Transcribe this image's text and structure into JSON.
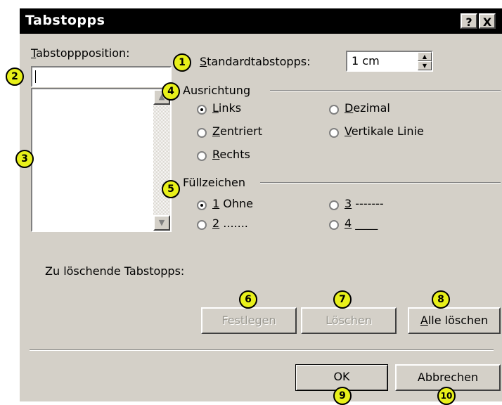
{
  "window": {
    "title": "Tabstopps",
    "help_btn": "?",
    "close_btn": "X"
  },
  "position": {
    "label_u": "T",
    "label_rest": "abstoppposition:",
    "value": "",
    "items": []
  },
  "standard": {
    "label_u": "S",
    "label_rest": "tandardtabstopps:",
    "value": "1 cm"
  },
  "alignment": {
    "title": "Ausrichtung",
    "options": [
      {
        "u": "L",
        "rest": "inks",
        "checked": true
      },
      {
        "u": "D",
        "rest": "ezimal",
        "checked": false
      },
      {
        "u": "Z",
        "rest": "entriert",
        "checked": false
      },
      {
        "u": "V",
        "rest": "ertikale Linie",
        "checked": false
      },
      {
        "u": "R",
        "rest": "echts",
        "checked": false
      }
    ]
  },
  "fill": {
    "title": "Füllzeichen",
    "options": [
      {
        "u": "1",
        "rest": " Ohne",
        "checked": true
      },
      {
        "u": "3",
        "rest": " -------",
        "checked": false
      },
      {
        "u": "2",
        "rest": " .......",
        "checked": false
      },
      {
        "u": "4",
        "rest": " ____",
        "checked": false
      }
    ]
  },
  "delete_label": "Zu löschende Tabstopps:",
  "buttons": {
    "set": "Festlegen",
    "delete": "Löschen",
    "delete_all_u": "A",
    "delete_all_rest": "lle löschen",
    "ok": "OK",
    "cancel": "Abbrechen"
  },
  "badges": [
    "1",
    "2",
    "3",
    "4",
    "5",
    "6",
    "7",
    "8",
    "9",
    "10"
  ],
  "badge_color": "#e8f01a"
}
